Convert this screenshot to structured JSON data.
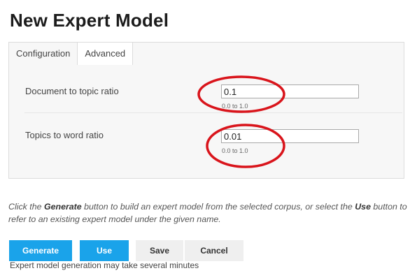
{
  "page": {
    "title": "New Expert Model"
  },
  "tabs": [
    {
      "label": "Configuration",
      "active": false
    },
    {
      "label": "Advanced",
      "active": true
    }
  ],
  "fields": {
    "doc_topic": {
      "label": "Document to topic ratio",
      "value": "0.1",
      "hint": "0.0 to 1.0"
    },
    "topic_word": {
      "label": "Topics to word ratio",
      "value": "0.01",
      "hint": "0.0 to 1.0"
    }
  },
  "instructions": {
    "p1": "Click the ",
    "generate": "Generate",
    "p2": " button to build an expert model from the selected corpus, or select the ",
    "use": "Use",
    "p3": " button to refer to an existing expert model under the given name."
  },
  "buttons": {
    "generate": "Generate",
    "use": "Use",
    "save": "Save",
    "cancel": "Cancel"
  },
  "status": "Expert model generation may take several minutes",
  "colors": {
    "primary_button": "#1aa3ea",
    "annotation_circle": "#d9141b"
  }
}
